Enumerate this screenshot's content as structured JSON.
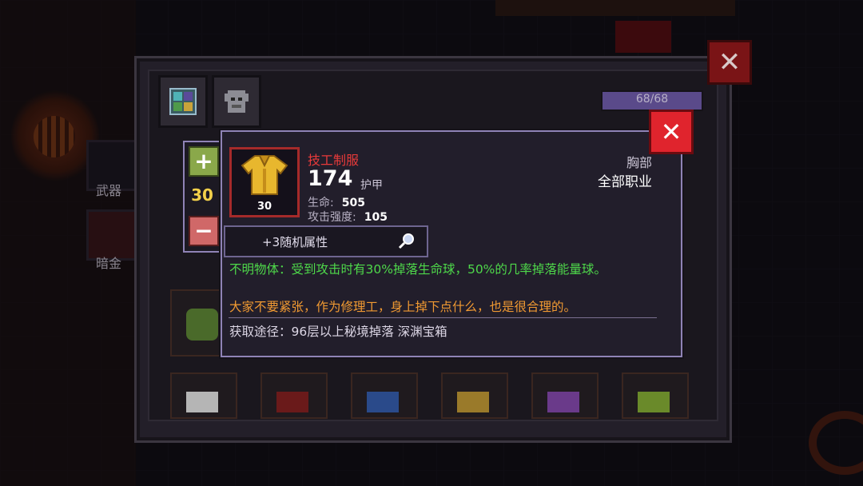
{
  "sidebar": {
    "weapons_label": "武器",
    "dark_gold_label": "暗金"
  },
  "inventory": {
    "capacity_text": "68/68",
    "capacity_fraction": 1.0
  },
  "tooltip": {
    "item_name": "技工制服",
    "item_level": "30",
    "armor_value": "174",
    "armor_label": "护甲",
    "stats": [
      {
        "label": "生命:",
        "value": "505"
      },
      {
        "label": "攻击强度:",
        "value": "105"
      }
    ],
    "slot_type": "胸部",
    "class_req": "全部职业",
    "level_adjust": {
      "plus": "+",
      "minus": "−",
      "value": "30"
    },
    "affix_text": "+3随机属性",
    "effect_text": "不明物体：受到攻击时有30%掉落生命球，50%的几率掉落能量球。",
    "flavor_text": "大家不要紧张，作为修理工，身上掉下点什么，也是很合理的。",
    "source_text": "获取途径：96层以上秘境掉落 深渊宝箱",
    "close_symbol": "✕"
  },
  "panel": {
    "close_symbol": "✕"
  },
  "colors": {
    "item_name": "#e83a3a",
    "effect": "#4ed84a",
    "flavor": "#f19a32",
    "level": "#f2d04a"
  }
}
